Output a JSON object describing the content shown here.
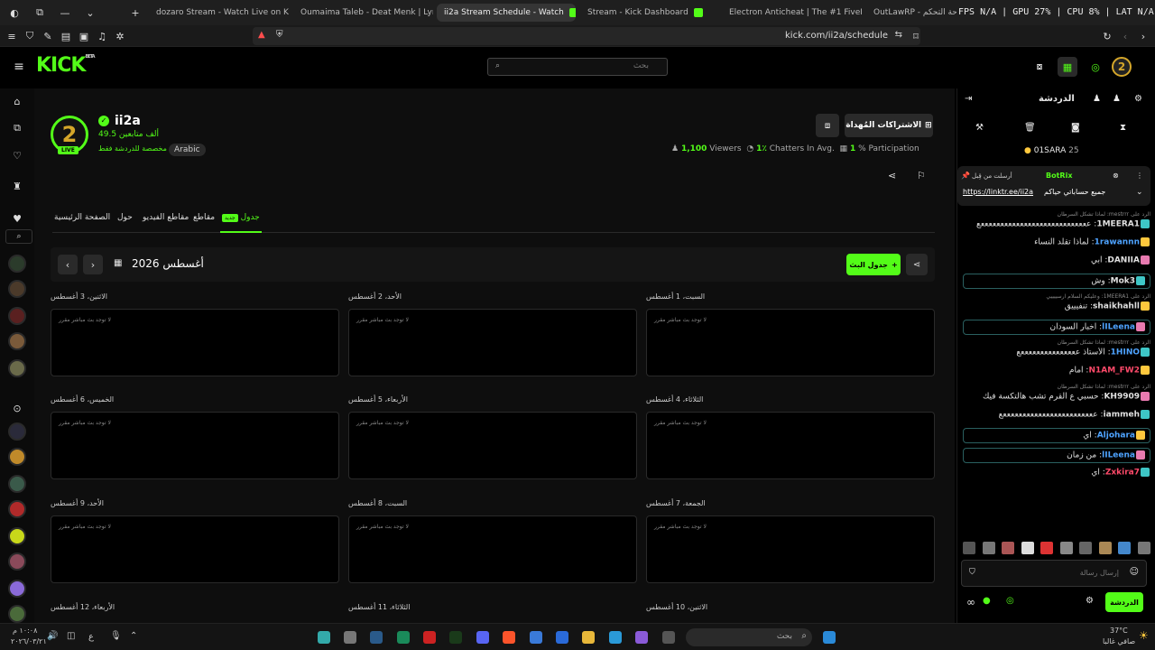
{
  "browser": {
    "tabs": [
      {
        "label": "dozaro Stream - Watch Live on K"
      },
      {
        "label": "Oumaima Taleb - Deat Menk | Lyr"
      },
      {
        "label": "ii2a Stream Schedule - Watch"
      },
      {
        "label": "Stream - Kick Dashboard"
      },
      {
        "label": "Electron Anticheat | The #1 FiveM An"
      },
      {
        "label": "OutLawRP - لوحة التحكم"
      }
    ],
    "perf_overlay": "FPS N/A | GPU 27% | CPU 8% | LAT N/A",
    "url": "kick.com/ii2a/schedule"
  },
  "header": {
    "logo": "KICK",
    "logo_sup": "BETA",
    "search_placeholder": "بحث"
  },
  "channel": {
    "name": "ii2a",
    "followers": "49.5 ألف متابعين",
    "chat_mode": "مخصصة للدردشة فقط",
    "language": "Arabic",
    "live_badge": "LIVE",
    "subs_button": "الاشتراكات المُهداة",
    "viewers": "1,100",
    "viewers_label": "Viewers",
    "chatters": "1٪",
    "chatters_label": "Chatters In Avg.",
    "participation": "1",
    "participation_label": "% Participation"
  },
  "tabs": [
    {
      "label": "الصفحة الرئيسية"
    },
    {
      "label": "حول"
    },
    {
      "label": "مقاطع الفيديو"
    },
    {
      "label": "مقاطع"
    },
    {
      "label": "جدول",
      "badge": "جديد"
    }
  ],
  "schedule": {
    "month": "أغسطس 2026",
    "add_button": "جدول البث",
    "empty": "لا توجد بث مباشر مقرر",
    "days": [
      {
        "label": "السبت، 1 أغسطس"
      },
      {
        "label": "الأحد، 2 أغسطس"
      },
      {
        "label": "الاثنين، 3 أغسطس"
      },
      {
        "label": "الثلاثاء، 4 أغسطس"
      },
      {
        "label": "الأربعاء، 5 أغسطس"
      },
      {
        "label": "الخميس، 6 أغسطس"
      },
      {
        "label": "الجمعة، 7 أغسطس"
      },
      {
        "label": "السبت، 8 أغسطس"
      },
      {
        "label": "الأحد، 9 أغسطس"
      },
      {
        "label": "الاثنين، 10 أغسطس"
      },
      {
        "label": "الثلاثاء، 11 أغسطس"
      },
      {
        "label": "الأربعاء، 12 أغسطس"
      }
    ]
  },
  "chat": {
    "title": "الدردشة",
    "top_user": "01SARA",
    "top_count": "25",
    "pinned_user": "BotRix",
    "pinned_by": "أرسلت من قِبل",
    "pinned_link": "https://linktr.ee/ii2a",
    "pinned_text": "جميع حساباتي حياكم",
    "messages": [
      {
        "reply": "الرد على mestrrr: لماذا تشكل السرطان",
        "user": "1MEERA1",
        "text": "ععععععععععععععععععععععععععععع",
        "color": "#e0e0e0"
      },
      {
        "reply": "",
        "user": "1rawannn",
        "text": "لماذا تقلّد النساء",
        "color": "#4ea3ff"
      },
      {
        "reply": "",
        "user": "DANIIA",
        "text": "ابي",
        "color": "#e0e0e0"
      },
      {
        "reply": "",
        "user": "Mok3",
        "text": "وش",
        "color": "#e0e0e0",
        "boxed": true
      },
      {
        "reply": "الرد على 1MEERA1: وعليكم السلام ارسييييي",
        "user": "shaikhahll",
        "text": "تنفيييق",
        "color": "#e0e0e0"
      },
      {
        "reply": "",
        "user": "lILeena",
        "text": "اخبار السودان",
        "color": "#4ea3ff",
        "boxed": true
      },
      {
        "reply": "الرد على mestrrr: لماذا تشكل السرطان",
        "user": "1HINO",
        "text": "الأستاذ عععععععععععععععع",
        "color": "#4ea3ff"
      },
      {
        "reply": "",
        "user": "N1AM_FW2",
        "text": "امام",
        "color": "#ff4a6a"
      },
      {
        "reply": "الرد على mestrrr: لماذا تشكل السرطان",
        "user": "KH9909",
        "text": "حسبي ع القرم تشب هالتكسة فيك",
        "color": "#e0e0e0"
      },
      {
        "reply": "",
        "user": "iammeh",
        "text": "ععععععععععععععععععععععععع",
        "color": "#e0e0e0"
      },
      {
        "reply": "",
        "user": "Aljohara",
        "text": "اي",
        "color": "#4ea3ff",
        "boxed": true
      },
      {
        "reply": "",
        "user": "lILeena",
        "text": "من زمان",
        "color": "#4ea3ff",
        "boxed": true
      },
      {
        "reply": "",
        "user": "Zxkira7",
        "text": "اي",
        "color": "#ff4a6a"
      }
    ],
    "input_placeholder": "إرسال رسالة",
    "send_label": "الدردشة"
  },
  "taskbar": {
    "search_placeholder": "بحث",
    "time": "١٠:٠٨ م",
    "date": "٢٠٢٦/٠٣/٢١",
    "weather_temp": "37°C",
    "weather_desc": "صافي غالبا",
    "lang": "ع"
  }
}
